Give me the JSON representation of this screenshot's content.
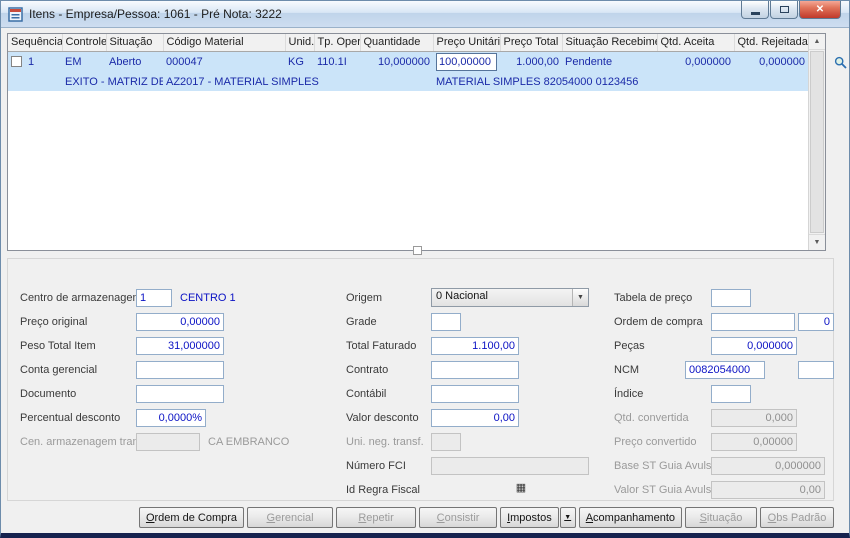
{
  "window": {
    "title": "Itens - Empresa/Pessoa: 1061 - Pré Nota: 3222"
  },
  "colors": {
    "selected_row": "#cbe4f9",
    "value_text": "#0b12c4",
    "titlebar": "#cdddf0",
    "close_button": "#c0392b"
  },
  "icons": {
    "close": "✕",
    "scroll_up": "▲",
    "scroll_down": "▼",
    "dropdown_arrow": "▼",
    "impostos_dropdown": "▼",
    "id_regra_lookup": "▦"
  },
  "grid": {
    "headers": {
      "sequencia": "Sequência",
      "controle": "Controle",
      "situacao": "Situação",
      "codigo_material": "Código Material",
      "unid": "Unid.",
      "tp_oper": "Tp. Oper.",
      "quantidade": "Quantidade",
      "preco_unitario": "Preço Unitário",
      "preco_total_item": "Preço Total Item",
      "situacao_recebimento": "Situação Recebimen.",
      "qtd_aceita": "Qtd. Aceita",
      "qtd_rejeitada": "Qtd. Rejeitada"
    },
    "row": {
      "sequencia": "1",
      "controle": "EM",
      "situacao": "Aberto",
      "codigo_material": "000047",
      "unid": "KG",
      "tp_oper": "110.1I",
      "quantidade": "10,000000",
      "preco_unitario": "100,00000",
      "preco_total_item": "1.000,00",
      "situacao_recebimento": "Pendente",
      "qtd_aceita": "0,000000",
      "qtd_rejeitada": "0,000000"
    },
    "detail": {
      "controle_desc": "EXITO - MATRIZ DE CON",
      "material_desc": "AZ2017 - MATERIAL SIMPLES",
      "item_desc": "MATERIAL SIMPLES 82054000 0123456"
    }
  },
  "form": {
    "centro_armazenagem": {
      "label": "Centro de armazenagem",
      "value": "1",
      "note": "CENTRO 1"
    },
    "preco_original": {
      "label": "Preço original",
      "value": "0,00000"
    },
    "peso_total_item": {
      "label": "Peso Total Item",
      "value": "31,000000"
    },
    "conta_gerencial": {
      "label": "Conta gerencial",
      "value": ""
    },
    "documento": {
      "label": "Documento",
      "value": ""
    },
    "percentual_desconto": {
      "label": "Percentual desconto",
      "value": "0,0000%"
    },
    "cen_armazenagem_transf": {
      "label": "Cen. armazenagem transf",
      "value": "",
      "note": "CA EMBRANCO"
    },
    "origem": {
      "label": "Origem",
      "value": "0 Nacional"
    },
    "grade": {
      "label": "Grade",
      "value": ""
    },
    "total_faturado": {
      "label": "Total Faturado",
      "value": "1.100,00"
    },
    "contrato": {
      "label": "Contrato",
      "value": ""
    },
    "contabil": {
      "label": "Contábil",
      "value": ""
    },
    "valor_desconto": {
      "label": "Valor desconto",
      "value": "0,00"
    },
    "uni_neg_transf": {
      "label": "Uni. neg. transf.",
      "value": ""
    },
    "numero_fci": {
      "label": "Número FCI",
      "value": ""
    },
    "id_regra_fiscal": {
      "label": "Id Regra Fiscal"
    },
    "tabela_preco": {
      "label": "Tabela de preço",
      "value": ""
    },
    "ordem_compra": {
      "label": "Ordem de compra",
      "value": "",
      "extra": "0"
    },
    "pecas": {
      "label": "Peças",
      "value": "0,000000"
    },
    "ncm": {
      "label": "NCM",
      "value": "0082054000",
      "extra": ""
    },
    "indice": {
      "label": "Índice",
      "value": ""
    },
    "qtd_convertida": {
      "label": "Qtd. convertida",
      "value": "0,000"
    },
    "preco_convertido": {
      "label": "Preço convertido",
      "value": "0,00000"
    },
    "base_st_guia_avulsa": {
      "label": "Base ST Guia Avulsa",
      "value": "0,000000"
    },
    "valor_st_guia_avulsa": {
      "label": "Valor ST Guia Avulsa",
      "value": "0,00"
    }
  },
  "buttons": {
    "ordem_de_compra": "Ordem de Compra",
    "gerencial": "Gerencial",
    "repetir": "Repetir",
    "consistir": "Consistir",
    "impostos": "Impostos",
    "acompanhamento": "Acompanhamento",
    "situacao": "Situação",
    "obs_padrao": "Obs Padrão"
  }
}
